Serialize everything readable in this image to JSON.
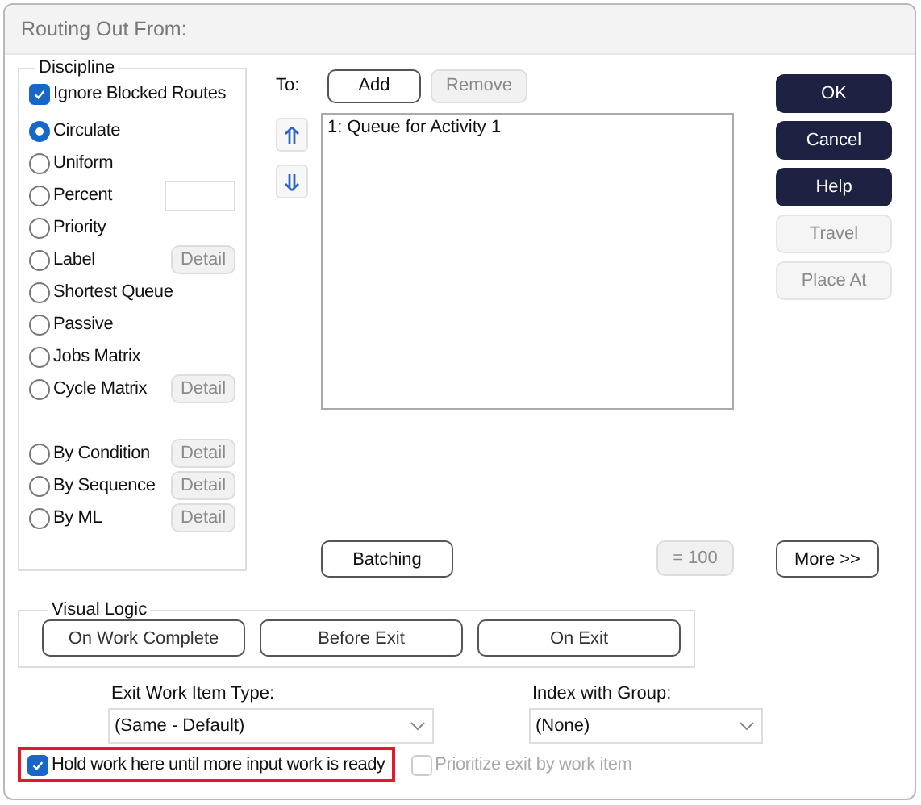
{
  "window": {
    "title": "Routing Out From:"
  },
  "discipline": {
    "title": "Discipline",
    "ignore_blocked_routes": {
      "label": "Ignore Blocked Routes",
      "checked": true
    },
    "option_groups": [
      [
        {
          "label": "Circulate",
          "selected": true,
          "kind": "plain"
        },
        {
          "label": "Uniform",
          "selected": false,
          "kind": "plain"
        },
        {
          "label": "Percent",
          "selected": false,
          "kind": "field"
        },
        {
          "label": "Priority",
          "selected": false,
          "kind": "plain"
        },
        {
          "label": "Label",
          "selected": false,
          "kind": "detail",
          "detail": {
            "label": "Detail",
            "disabled": true
          }
        },
        {
          "label": "Shortest Queue",
          "selected": false,
          "kind": "plain"
        },
        {
          "label": "Passive",
          "selected": false,
          "kind": "plain"
        },
        {
          "label": "Jobs Matrix",
          "selected": false,
          "kind": "plain"
        },
        {
          "label": "Cycle Matrix",
          "selected": false,
          "kind": "detail",
          "detail": {
            "label": "Detail",
            "disabled": true
          }
        }
      ],
      [
        {
          "label": "By Condition",
          "selected": false,
          "kind": "detail",
          "detail": {
            "label": "Detail",
            "disabled": true
          }
        },
        {
          "label": "By Sequence",
          "selected": false,
          "kind": "detail",
          "detail": {
            "label": "Detail",
            "disabled": true
          }
        },
        {
          "label": "By ML",
          "selected": false,
          "kind": "detail",
          "detail": {
            "label": "Detail",
            "disabled": true
          }
        }
      ]
    ]
  },
  "routing": {
    "to_label": "To:",
    "add": {
      "label": "Add",
      "disabled": false
    },
    "remove": {
      "label": "Remove",
      "disabled": true
    },
    "destinations": [
      "1: Queue for Activity 1"
    ],
    "batching": {
      "label": "Batching",
      "disabled": false
    },
    "percent_total": {
      "label": "= 100",
      "disabled": true
    },
    "more": {
      "label": "More >>",
      "disabled": false
    }
  },
  "side_buttons": [
    {
      "label": "OK",
      "disabled": false
    },
    {
      "label": "Cancel",
      "disabled": false
    },
    {
      "label": "Help",
      "disabled": false
    },
    {
      "label": "Travel",
      "disabled": true
    },
    {
      "label": "Place At",
      "disabled": true
    }
  ],
  "visual_logic": {
    "title": "Visual Logic",
    "buttons": [
      "On Work  Complete",
      "Before Exit",
      "On Exit"
    ]
  },
  "exit_work_item_type": {
    "label": "Exit Work Item Type:",
    "value": "(Same - Default)"
  },
  "index_with_group": {
    "label": "Index with Group:",
    "value": "(None)"
  },
  "hold_work": {
    "label": "Hold work here until more input work is ready",
    "checked": true,
    "highlighted": true
  },
  "prioritize_exit": {
    "label": "Prioritize exit by work item",
    "checked": false,
    "disabled": true
  }
}
